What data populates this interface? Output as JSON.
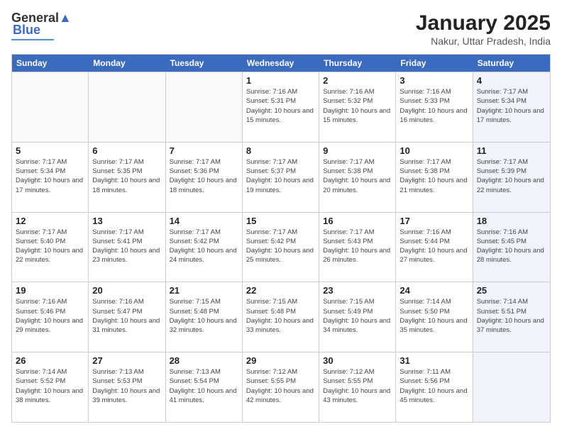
{
  "logo": {
    "line1": "General",
    "line2": "Blue"
  },
  "title": "January 2025",
  "location": "Nakur, Uttar Pradesh, India",
  "days_of_week": [
    "Sunday",
    "Monday",
    "Tuesday",
    "Wednesday",
    "Thursday",
    "Friday",
    "Saturday"
  ],
  "weeks": [
    [
      {
        "day": "",
        "sunrise": "",
        "sunset": "",
        "daylight": "",
        "empty": true
      },
      {
        "day": "",
        "sunrise": "",
        "sunset": "",
        "daylight": "",
        "empty": true
      },
      {
        "day": "",
        "sunrise": "",
        "sunset": "",
        "daylight": "",
        "empty": true
      },
      {
        "day": "1",
        "sunrise": "Sunrise: 7:16 AM",
        "sunset": "Sunset: 5:31 PM",
        "daylight": "Daylight: 10 hours and 15 minutes."
      },
      {
        "day": "2",
        "sunrise": "Sunrise: 7:16 AM",
        "sunset": "Sunset: 5:32 PM",
        "daylight": "Daylight: 10 hours and 15 minutes."
      },
      {
        "day": "3",
        "sunrise": "Sunrise: 7:16 AM",
        "sunset": "Sunset: 5:33 PM",
        "daylight": "Daylight: 10 hours and 16 minutes."
      },
      {
        "day": "4",
        "sunrise": "Sunrise: 7:17 AM",
        "sunset": "Sunset: 5:34 PM",
        "daylight": "Daylight: 10 hours and 17 minutes.",
        "saturday": true
      }
    ],
    [
      {
        "day": "5",
        "sunrise": "Sunrise: 7:17 AM",
        "sunset": "Sunset: 5:34 PM",
        "daylight": "Daylight: 10 hours and 17 minutes."
      },
      {
        "day": "6",
        "sunrise": "Sunrise: 7:17 AM",
        "sunset": "Sunset: 5:35 PM",
        "daylight": "Daylight: 10 hours and 18 minutes."
      },
      {
        "day": "7",
        "sunrise": "Sunrise: 7:17 AM",
        "sunset": "Sunset: 5:36 PM",
        "daylight": "Daylight: 10 hours and 18 minutes."
      },
      {
        "day": "8",
        "sunrise": "Sunrise: 7:17 AM",
        "sunset": "Sunset: 5:37 PM",
        "daylight": "Daylight: 10 hours and 19 minutes."
      },
      {
        "day": "9",
        "sunrise": "Sunrise: 7:17 AM",
        "sunset": "Sunset: 5:38 PM",
        "daylight": "Daylight: 10 hours and 20 minutes."
      },
      {
        "day": "10",
        "sunrise": "Sunrise: 7:17 AM",
        "sunset": "Sunset: 5:38 PM",
        "daylight": "Daylight: 10 hours and 21 minutes."
      },
      {
        "day": "11",
        "sunrise": "Sunrise: 7:17 AM",
        "sunset": "Sunset: 5:39 PM",
        "daylight": "Daylight: 10 hours and 22 minutes.",
        "saturday": true
      }
    ],
    [
      {
        "day": "12",
        "sunrise": "Sunrise: 7:17 AM",
        "sunset": "Sunset: 5:40 PM",
        "daylight": "Daylight: 10 hours and 22 minutes."
      },
      {
        "day": "13",
        "sunrise": "Sunrise: 7:17 AM",
        "sunset": "Sunset: 5:41 PM",
        "daylight": "Daylight: 10 hours and 23 minutes."
      },
      {
        "day": "14",
        "sunrise": "Sunrise: 7:17 AM",
        "sunset": "Sunset: 5:42 PM",
        "daylight": "Daylight: 10 hours and 24 minutes."
      },
      {
        "day": "15",
        "sunrise": "Sunrise: 7:17 AM",
        "sunset": "Sunset: 5:42 PM",
        "daylight": "Daylight: 10 hours and 25 minutes."
      },
      {
        "day": "16",
        "sunrise": "Sunrise: 7:17 AM",
        "sunset": "Sunset: 5:43 PM",
        "daylight": "Daylight: 10 hours and 26 minutes."
      },
      {
        "day": "17",
        "sunrise": "Sunrise: 7:16 AM",
        "sunset": "Sunset: 5:44 PM",
        "daylight": "Daylight: 10 hours and 27 minutes."
      },
      {
        "day": "18",
        "sunrise": "Sunrise: 7:16 AM",
        "sunset": "Sunset: 5:45 PM",
        "daylight": "Daylight: 10 hours and 28 minutes.",
        "saturday": true
      }
    ],
    [
      {
        "day": "19",
        "sunrise": "Sunrise: 7:16 AM",
        "sunset": "Sunset: 5:46 PM",
        "daylight": "Daylight: 10 hours and 29 minutes."
      },
      {
        "day": "20",
        "sunrise": "Sunrise: 7:16 AM",
        "sunset": "Sunset: 5:47 PM",
        "daylight": "Daylight: 10 hours and 31 minutes."
      },
      {
        "day": "21",
        "sunrise": "Sunrise: 7:15 AM",
        "sunset": "Sunset: 5:48 PM",
        "daylight": "Daylight: 10 hours and 32 minutes."
      },
      {
        "day": "22",
        "sunrise": "Sunrise: 7:15 AM",
        "sunset": "Sunset: 5:48 PM",
        "daylight": "Daylight: 10 hours and 33 minutes."
      },
      {
        "day": "23",
        "sunrise": "Sunrise: 7:15 AM",
        "sunset": "Sunset: 5:49 PM",
        "daylight": "Daylight: 10 hours and 34 minutes."
      },
      {
        "day": "24",
        "sunrise": "Sunrise: 7:14 AM",
        "sunset": "Sunset: 5:50 PM",
        "daylight": "Daylight: 10 hours and 35 minutes."
      },
      {
        "day": "25",
        "sunrise": "Sunrise: 7:14 AM",
        "sunset": "Sunset: 5:51 PM",
        "daylight": "Daylight: 10 hours and 37 minutes.",
        "saturday": true
      }
    ],
    [
      {
        "day": "26",
        "sunrise": "Sunrise: 7:14 AM",
        "sunset": "Sunset: 5:52 PM",
        "daylight": "Daylight: 10 hours and 38 minutes."
      },
      {
        "day": "27",
        "sunrise": "Sunrise: 7:13 AM",
        "sunset": "Sunset: 5:53 PM",
        "daylight": "Daylight: 10 hours and 39 minutes."
      },
      {
        "day": "28",
        "sunrise": "Sunrise: 7:13 AM",
        "sunset": "Sunset: 5:54 PM",
        "daylight": "Daylight: 10 hours and 41 minutes."
      },
      {
        "day": "29",
        "sunrise": "Sunrise: 7:12 AM",
        "sunset": "Sunset: 5:55 PM",
        "daylight": "Daylight: 10 hours and 42 minutes."
      },
      {
        "day": "30",
        "sunrise": "Sunrise: 7:12 AM",
        "sunset": "Sunset: 5:55 PM",
        "daylight": "Daylight: 10 hours and 43 minutes."
      },
      {
        "day": "31",
        "sunrise": "Sunrise: 7:11 AM",
        "sunset": "Sunset: 5:56 PM",
        "daylight": "Daylight: 10 hours and 45 minutes."
      },
      {
        "day": "",
        "sunrise": "",
        "sunset": "",
        "daylight": "",
        "empty": true,
        "saturday": true
      }
    ]
  ]
}
